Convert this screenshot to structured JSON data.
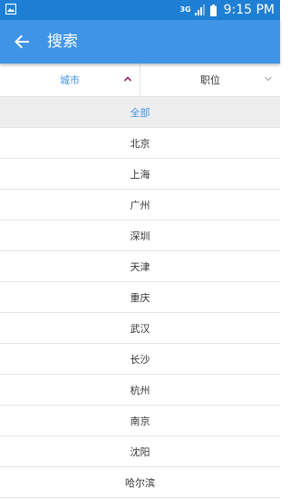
{
  "status_bar": {
    "network": "3G",
    "time": "9:15 PM"
  },
  "app_bar": {
    "title": "搜索"
  },
  "filters": {
    "city_label": "城市",
    "position_label": "职位"
  },
  "cities": [
    "全部",
    "北京",
    "上海",
    "广州",
    "深圳",
    "天津",
    "重庆",
    "武汉",
    "长沙",
    "杭州",
    "南京",
    "沈阳",
    "哈尔滨"
  ],
  "selected_index": 0,
  "colors": {
    "status_bar": "#1e7fd4",
    "app_bar": "#3f94e6",
    "accent": "#3f94e6",
    "chevron_active": "#8b2a6b"
  }
}
